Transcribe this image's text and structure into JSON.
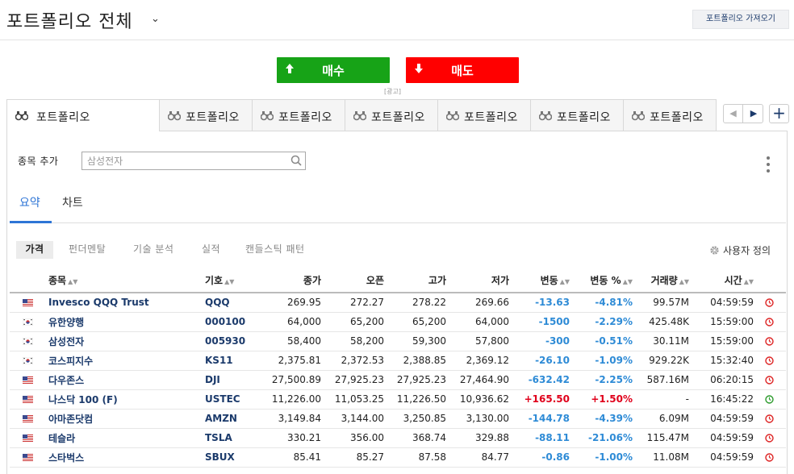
{
  "header": {
    "title": "포트폴리오 전체",
    "caret": "⌄",
    "import_button": "포트폴리오 가져오기"
  },
  "trade": {
    "buy_label": "매수",
    "sell_label": "매도",
    "ad_label": "[광고]"
  },
  "tabs": [
    {
      "label": "포트폴리오"
    },
    {
      "label": "포트폴리오"
    },
    {
      "label": "포트폴리오"
    },
    {
      "label": "포트폴리오"
    },
    {
      "label": "포트폴리오"
    },
    {
      "label": "포트폴리오"
    },
    {
      "label": "포트폴리오"
    }
  ],
  "tab_nav": {
    "prev": "◀",
    "next": "▶",
    "add": "+"
  },
  "add_symbol": {
    "label": "종목 추가",
    "placeholder": "삼성전자"
  },
  "view_tabs": [
    {
      "label": "요약"
    },
    {
      "label": "차트"
    }
  ],
  "sub_tabs": [
    {
      "label": "가격"
    },
    {
      "label": "펀더멘탈"
    },
    {
      "label": "기술 분석"
    },
    {
      "label": "실적"
    },
    {
      "label": "캔들스틱 패턴"
    }
  ],
  "custom_label": "사용자 정의",
  "colors": {
    "accent": "#2e75d6",
    "buy": "#17a317",
    "sell": "#ff0000",
    "negative": "#2e8bd6",
    "positive": "#e0001b"
  },
  "columns": [
    "종목",
    "기호",
    "종가",
    "오픈",
    "고가",
    "저가",
    "변동",
    "변동 %",
    "거래량",
    "시간"
  ],
  "rows": [
    {
      "flag": "us",
      "name": "Invesco QQQ Trust",
      "symbol": "QQQ",
      "close": "269.95",
      "open": "272.27",
      "high": "278.22",
      "low": "269.66",
      "change": "-13.63",
      "pct": "-4.81%",
      "volume": "99.57M",
      "time": "04:59:59",
      "dir": "neg",
      "status": "closed"
    },
    {
      "flag": "kr",
      "name": "유한양행",
      "symbol": "000100",
      "close": "64,000",
      "open": "65,200",
      "high": "65,200",
      "low": "64,000",
      "change": "-1500",
      "pct": "-2.29%",
      "volume": "425.48K",
      "time": "15:59:00",
      "dir": "neg",
      "status": "closed"
    },
    {
      "flag": "kr",
      "name": "삼성전자",
      "symbol": "005930",
      "close": "58,400",
      "open": "58,200",
      "high": "59,300",
      "low": "57,800",
      "change": "-300",
      "pct": "-0.51%",
      "volume": "30.11M",
      "time": "15:59:00",
      "dir": "neg",
      "status": "closed"
    },
    {
      "flag": "kr",
      "name": "코스피지수",
      "symbol": "KS11",
      "close": "2,375.81",
      "open": "2,372.53",
      "high": "2,388.85",
      "low": "2,369.12",
      "change": "-26.10",
      "pct": "-1.09%",
      "volume": "929.22K",
      "time": "15:32:40",
      "dir": "neg",
      "status": "closed"
    },
    {
      "flag": "us",
      "name": "다우존스",
      "symbol": "DJI",
      "close": "27,500.89",
      "open": "27,925.23",
      "high": "27,925.23",
      "low": "27,464.90",
      "change": "-632.42",
      "pct": "-2.25%",
      "volume": "587.16M",
      "time": "06:20:15",
      "dir": "neg",
      "status": "closed"
    },
    {
      "flag": "us",
      "name": "나스닥 100 (F)",
      "symbol": "USTEC",
      "close": "11,226.00",
      "open": "11,053.25",
      "high": "11,226.50",
      "low": "10,936.62",
      "change": "+165.50",
      "pct": "+1.50%",
      "volume": "-",
      "time": "16:45:22",
      "dir": "pos",
      "status": "open"
    },
    {
      "flag": "us",
      "name": "아마존닷컴",
      "symbol": "AMZN",
      "close": "3,149.84",
      "open": "3,144.00",
      "high": "3,250.85",
      "low": "3,130.00",
      "change": "-144.78",
      "pct": "-4.39%",
      "volume": "6.09M",
      "time": "04:59:59",
      "dir": "neg",
      "status": "closed"
    },
    {
      "flag": "us",
      "name": "테슬라",
      "symbol": "TSLA",
      "close": "330.21",
      "open": "356.00",
      "high": "368.74",
      "low": "329.88",
      "change": "-88.11",
      "pct": "-21.06%",
      "volume": "115.47M",
      "time": "04:59:59",
      "dir": "neg",
      "status": "closed"
    },
    {
      "flag": "us",
      "name": "스타벅스",
      "symbol": "SBUX",
      "close": "85.41",
      "open": "85.27",
      "high": "87.58",
      "low": "84.77",
      "change": "-0.86",
      "pct": "-1.00%",
      "volume": "11.08M",
      "time": "04:59:59",
      "dir": "neg",
      "status": "closed"
    }
  ]
}
